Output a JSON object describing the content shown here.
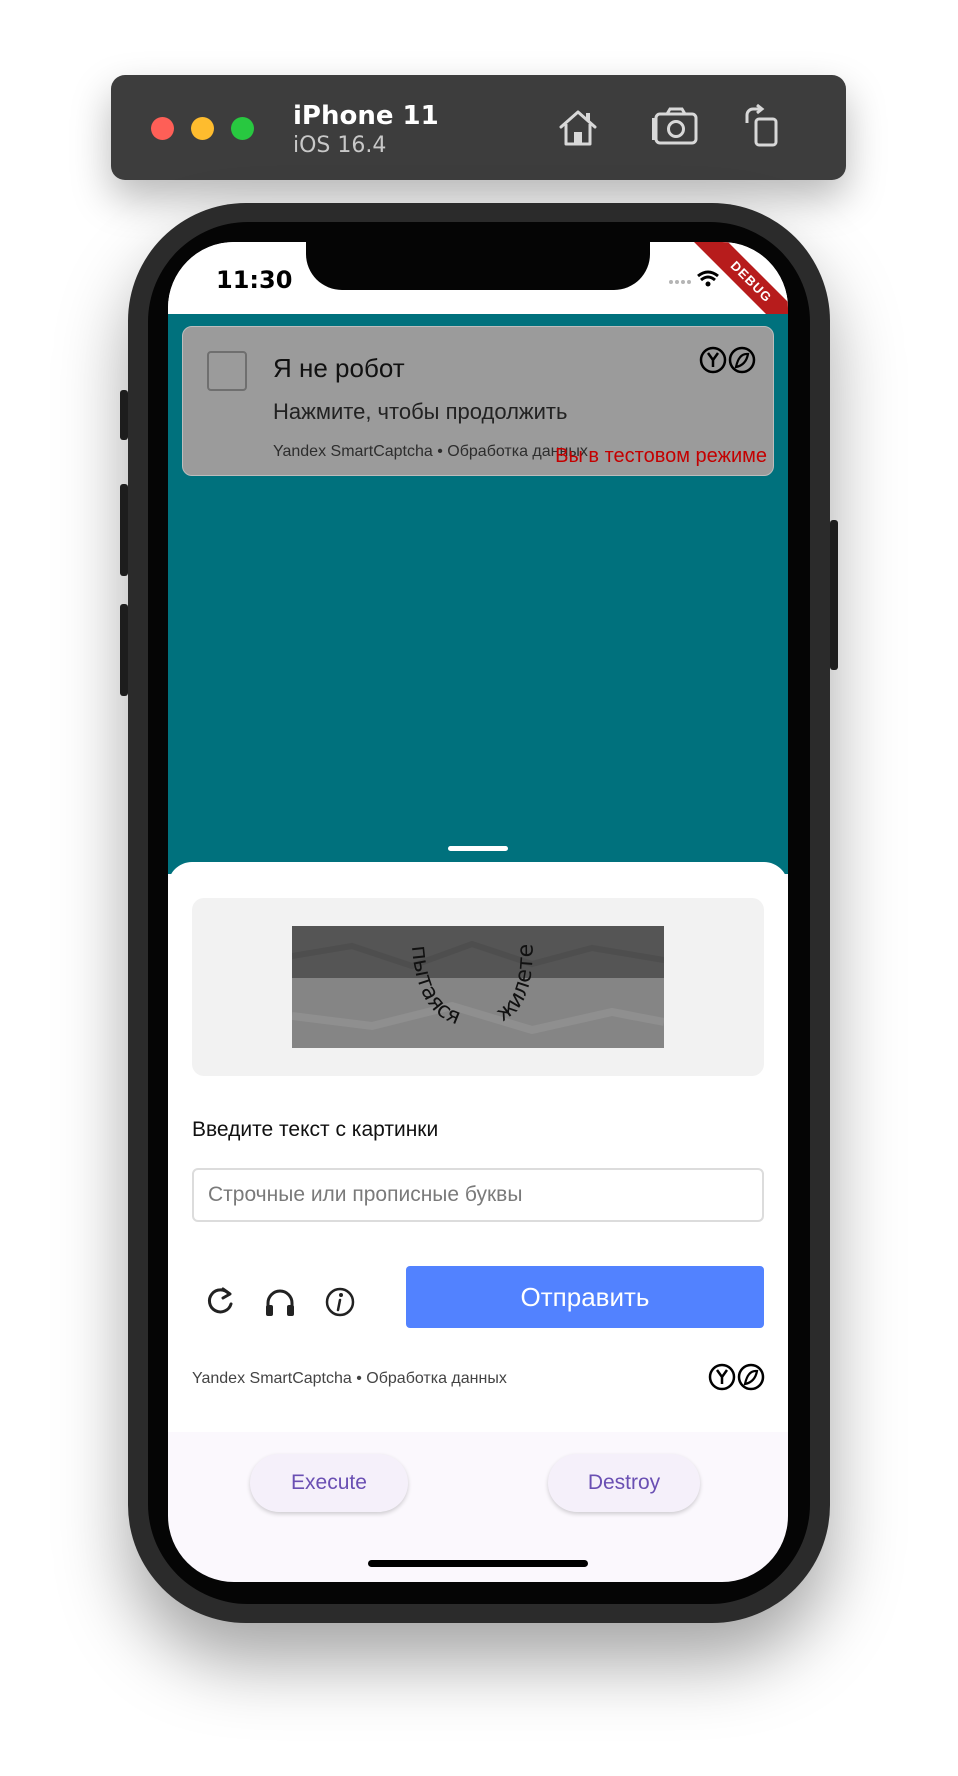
{
  "simulator": {
    "device_name": "iPhone 11",
    "os_version": "iOS 16.4",
    "toolbar_icons": [
      "home-icon",
      "screenshot-icon",
      "rotate-icon"
    ]
  },
  "status_bar": {
    "time": "11:30",
    "debug_banner": "DEBUG"
  },
  "captcha_widget": {
    "title": "Я не робот",
    "subtitle": "Нажмите, чтобы продолжить",
    "footer": "Yandex SmartCaptcha • Обработка данных",
    "test_mode": "Вы в тестовом режиме"
  },
  "challenge": {
    "image_text_left": "пытаяся",
    "image_text_right": "жилете",
    "input_label": "Введите текст с картинки",
    "input_placeholder": "Строчные или прописные буквы",
    "input_value": "",
    "submit_label": "Отправить",
    "footer": "Yandex SmartCaptcha • Обработка данных",
    "action_icons": [
      "refresh-icon",
      "headphones-icon",
      "info-icon"
    ]
  },
  "actions": {
    "execute_label": "Execute",
    "destroy_label": "Destroy"
  },
  "colors": {
    "teal_background": "#00717d",
    "submit_blue": "#5282ff",
    "test_mode_red": "#c40000",
    "button_text_purple": "#6a4fb3"
  }
}
